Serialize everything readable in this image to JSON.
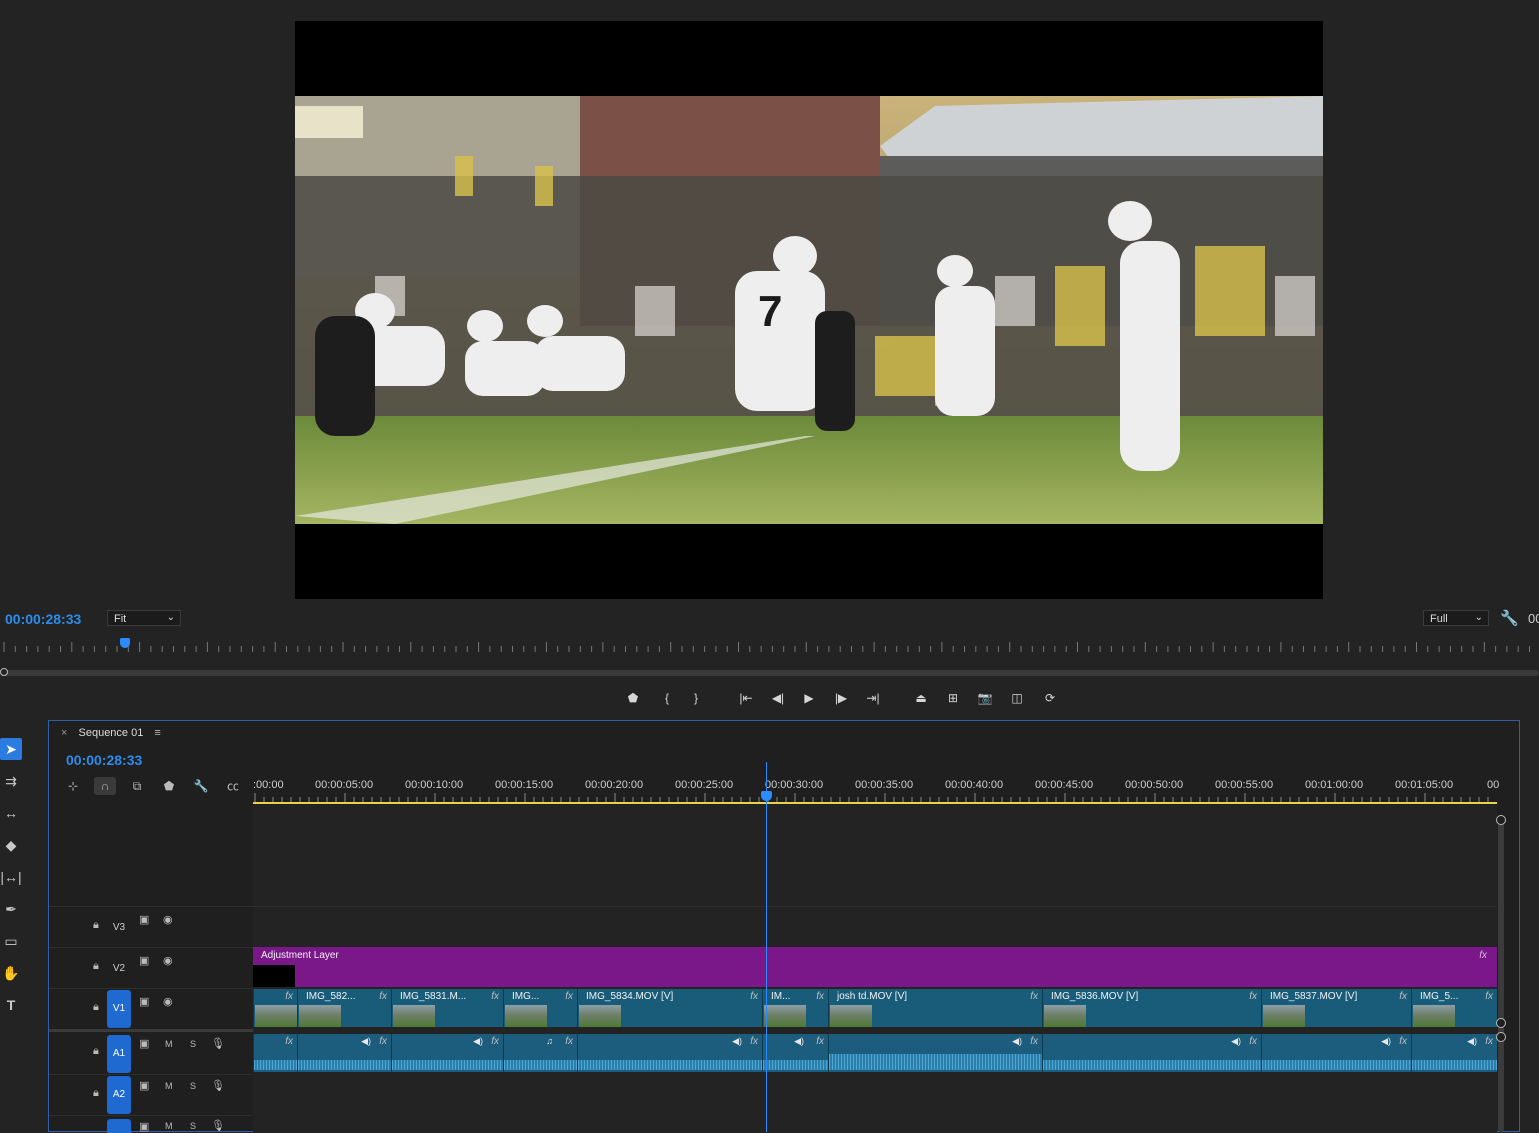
{
  "program_monitor": {
    "timecode": "00:00:28:33",
    "zoom_select": "Fit",
    "quality_select": "Full",
    "right_cut_text": "00"
  },
  "transport": {
    "icons": [
      "add-marker-icon",
      "mark-in-icon",
      "mark-out-icon",
      "go-to-in-icon",
      "step-back-icon",
      "play-icon",
      "step-forward-icon",
      "go-to-out-icon",
      "lift-icon",
      "extract-icon",
      "export-frame-icon",
      "compare-view-icon",
      "button-editor-icon"
    ]
  },
  "tools": [
    "selection-tool",
    "track-select-tool",
    "ripple-edit-tool",
    "razor-tool",
    "slip-tool",
    "pen-tool",
    "rectangle-tool",
    "hand-tool",
    "type-tool"
  ],
  "sequence": {
    "tab_close": "×",
    "tab_title": "Sequence 01",
    "tab_menu": "≡",
    "timecode": "00:00:28:33"
  },
  "ruler": {
    "labels": [
      ":00:00",
      "00:00:05:00",
      "00:00:10:00",
      "00:00:15:00",
      "00:00:20:00",
      "00:00:25:00",
      "00:00:30:00",
      "00:00:35:00",
      "00:00:40:00",
      "00:00:45:00",
      "00:00:50:00",
      "00:00:55:00",
      "00:01:00:00",
      "00:01:05:00",
      "00"
    ]
  },
  "tracks": {
    "v3": "V3",
    "v2": "V2",
    "v1": "V1",
    "a1": "A1",
    "a2": "A2",
    "mute": "M",
    "solo": "S"
  },
  "clips": {
    "adjustment_layer": "Adjustment Layer",
    "fx": "fx",
    "video": [
      "IMG_582...",
      "IMG_5831.M...",
      "IMG...",
      "IMG_5834.MOV [V]",
      "IM...",
      "josh td.MOV [V]",
      "IMG_5836.MOV [V]",
      "IMG_5837.MOV [V]",
      "IMG_5..."
    ]
  }
}
